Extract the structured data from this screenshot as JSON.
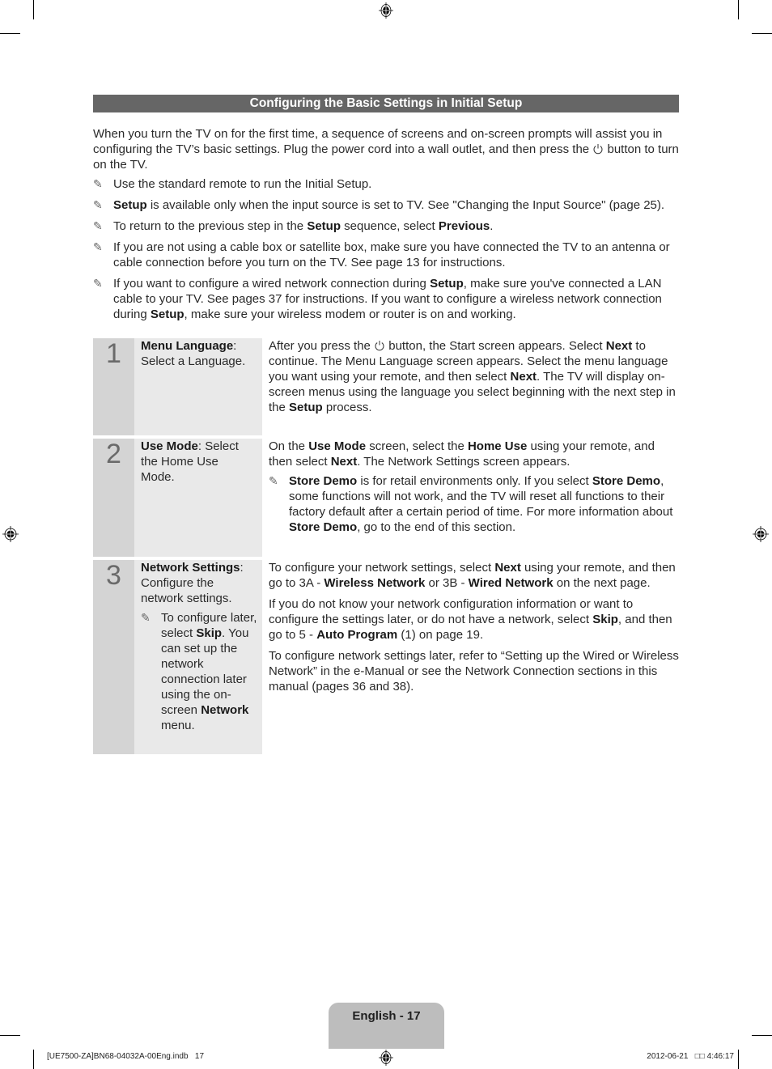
{
  "header": {
    "title": "Configuring the Basic Settings in Initial Setup"
  },
  "intro": {
    "text_before_icon": "When you turn the TV on for the first time, a sequence of screens and on-screen prompts will assist you in configuring the TV’s basic settings. Plug the power cord into a wall outlet, and then press the ",
    "power_icon": "power-icon",
    "text_after_icon": " button to turn on the TV."
  },
  "notes": [
    {
      "parts": [
        {
          "t": "Use the standard remote to run the Initial Setup."
        }
      ]
    },
    {
      "parts": [
        {
          "t": "Setup",
          "b": true
        },
        {
          "t": " is available only when the input source is set to TV. See \"Changing the Input Source\" (page 25)."
        }
      ]
    },
    {
      "parts": [
        {
          "t": "To return to the previous step in the "
        },
        {
          "t": "Setup",
          "b": true
        },
        {
          "t": " sequence, select "
        },
        {
          "t": "Previous",
          "b": true
        },
        {
          "t": "."
        }
      ]
    },
    {
      "parts": [
        {
          "t": "If you are not using a cable box or satellite box, make sure you have connected the TV to an antenna or cable connection before you turn on the TV. See page 13 for instructions."
        }
      ]
    },
    {
      "parts": [
        {
          "t": "If you want to configure a wired network connection during "
        },
        {
          "t": "Setup",
          "b": true
        },
        {
          "t": ", make sure you've connected a LAN cable to your TV. See pages 37 for instructions. If you want to configure a wireless network connection during "
        },
        {
          "t": "Setup",
          "b": true
        },
        {
          "t": ", make sure your wireless modem or router is on and working."
        }
      ]
    }
  ],
  "note_icon": "note-pencil-icon",
  "steps": [
    {
      "number": "1",
      "desc": [
        {
          "t": "Menu Language",
          "b": true
        },
        {
          "t": ": Select a Language."
        }
      ],
      "desc_note": null,
      "body": [
        [
          {
            "t": "After you press the "
          },
          {
            "icon": "power"
          },
          {
            "t": " button, the Start screen appears. Select "
          },
          {
            "t": "Next",
            "b": true
          },
          {
            "t": " to continue. The Menu Language screen appears. Select the menu language you want using your remote, and then select "
          },
          {
            "t": "Next",
            "b": true
          },
          {
            "t": ". The TV will display on-screen menus using the language you select beginning with the next step in the "
          },
          {
            "t": "Setup",
            "b": true
          },
          {
            "t": " process."
          }
        ]
      ],
      "body_note": null
    },
    {
      "number": "2",
      "desc": [
        {
          "t": "Use Mode",
          "b": true
        },
        {
          "t": ": Select the Home Use Mode."
        }
      ],
      "desc_note": null,
      "body": [
        [
          {
            "t": "On the "
          },
          {
            "t": "Use Mode",
            "b": true
          },
          {
            "t": " screen, select the "
          },
          {
            "t": "Home Use",
            "b": true
          },
          {
            "t": " using your remote, and then select "
          },
          {
            "t": "Next",
            "b": true
          },
          {
            "t": ". The Network Settings screen appears."
          }
        ]
      ],
      "body_note": [
        {
          "t": "Store Demo",
          "b": true
        },
        {
          "t": " is for retail environments only. If you select "
        },
        {
          "t": "Store Demo",
          "b": true
        },
        {
          "t": ", some functions will not work, and the TV will reset all functions to their factory default after a certain period of time. For more information about "
        },
        {
          "t": "Store Demo",
          "b": true
        },
        {
          "t": ", go to the end of this section."
        }
      ]
    },
    {
      "number": "3",
      "desc": [
        {
          "t": "Network Settings",
          "b": true
        },
        {
          "t": ": Configure the network settings."
        }
      ],
      "desc_note": [
        {
          "t": "To configure later, select "
        },
        {
          "t": "Skip",
          "b": true
        },
        {
          "t": ". You can set up the network connection later using the on-screen "
        },
        {
          "t": "Network",
          "b": true
        },
        {
          "t": " menu."
        }
      ],
      "body": [
        [
          {
            "t": "To configure your network settings, select "
          },
          {
            "t": "Next",
            "b": true
          },
          {
            "t": " using your remote, and then go to 3A - "
          },
          {
            "t": "Wireless Network",
            "b": true
          },
          {
            "t": " or 3B - "
          },
          {
            "t": "Wired Network",
            "b": true
          },
          {
            "t": " on the next page."
          }
        ],
        [
          {
            "t": "If you do not know your network configuration information or want to configure the settings later, or do not have a network, select "
          },
          {
            "t": "Skip",
            "b": true
          },
          {
            "t": ", and then go to 5 - "
          },
          {
            "t": "Auto Program",
            "b": true
          },
          {
            "t": " (1) on page 19."
          }
        ],
        [
          {
            "t": "To configure network settings later, refer to “Setting up the Wired or Wireless Network” in the e-Manual or see the Network Connection sections in this manual (pages 36 and 38)."
          }
        ]
      ],
      "body_note": null
    }
  ],
  "footer": {
    "page_label": "English - 17",
    "slug_left": "[UE7500-ZA]BN68-04032A-00Eng.indb   17",
    "slug_right": "2012-06-21   □□ 4:46:17"
  }
}
